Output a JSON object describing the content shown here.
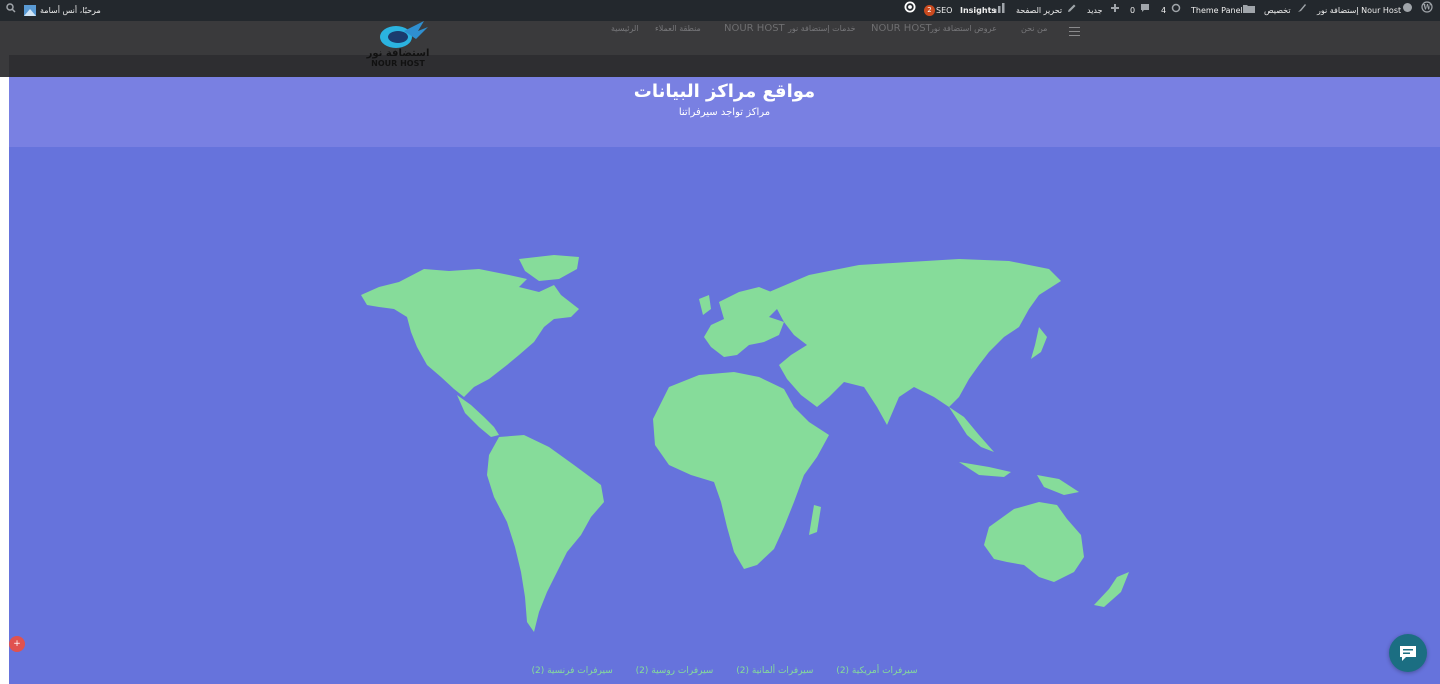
{
  "admin_bar": {
    "site_name": "إستضافة نور Nour Host",
    "customize": "تخصيص",
    "theme_panel": "Theme Panel",
    "updates_count": "4",
    "comments_count": "0",
    "new_label": "جديد",
    "edit_page": "تحرير الصفحة",
    "insights": "Insights",
    "seo": "SEO",
    "seo_badge": "2",
    "greeting": "مرحبًا، أنس أسامة"
  },
  "nav": {
    "items": [
      "الرئيسية",
      "منطقة العملاء",
      "NOUR HOST",
      "خدمات إستضافة نور",
      "NOUR HOST",
      "عروض استضافة نور",
      "من نحن"
    ]
  },
  "logo": {
    "arabic": "استضافة نور",
    "latin": "NOUR HOST"
  },
  "page": {
    "title": "مواقع مراكز البيانات",
    "subtitle": "مراكز تواجد سيرفراتنا"
  },
  "legend": [
    "سيرفرات فرنسية (2)",
    "سيرفرات روسية (2)",
    "سيرفرات ألمانية (2)",
    "سيرفرات أمريكية (2)"
  ],
  "colors": {
    "admin_bar": "#23282d",
    "banner": "#7980e2",
    "map_background": "#6673dc",
    "land": "#86dc9a",
    "chat_button": "#1b6e82"
  },
  "icons": [
    "wordpress-icon",
    "dashboard-icon",
    "brush-icon",
    "folder-icon",
    "refresh-icon",
    "comment-icon",
    "plus-icon",
    "pencil-icon",
    "chart-bar-icon",
    "settings-icon",
    "search-icon",
    "avatar",
    "menu-icon",
    "chat-icon"
  ]
}
